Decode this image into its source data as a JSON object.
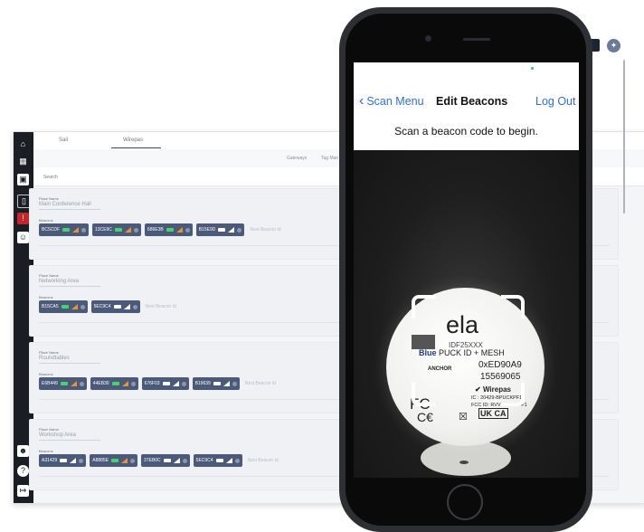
{
  "desktop": {
    "top_tabs": [
      "Sail",
      "Wirepas"
    ],
    "sub_tabs": [
      "Gateways",
      "Tag Man"
    ],
    "search_label": "Search",
    "place_name_label": "Place Name",
    "beacons_label": "Beacons",
    "next_beacon_placeholder": "Next Beacon Id",
    "places": [
      {
        "name": "Main Conference Hall",
        "beacons": [
          {
            "id": "BC5CDF",
            "battery": "green",
            "signal": "orange"
          },
          {
            "id": "13CE9C",
            "battery": "green",
            "signal": "orange"
          },
          {
            "id": "686E3B",
            "battery": "green",
            "signal": "orange"
          },
          {
            "id": "B15E9D",
            "battery": "white",
            "signal": "white"
          }
        ]
      },
      {
        "name": "Networking Area",
        "beacons": [
          {
            "id": "B15CA5",
            "battery": "green",
            "signal": "orange"
          },
          {
            "id": "5EC9C4",
            "battery": "white",
            "signal": "white"
          }
        ]
      },
      {
        "name": "Roundtables",
        "beacons": [
          {
            "id": "E6B449",
            "battery": "green",
            "signal": "orange"
          },
          {
            "id": "44EB30",
            "battery": "green",
            "signal": "orange"
          },
          {
            "id": "676F03",
            "battery": "white",
            "signal": "white"
          },
          {
            "id": "B19639",
            "battery": "white",
            "signal": "white"
          }
        ]
      },
      {
        "name": "Workshop Area",
        "beacons": [
          {
            "id": "A31429",
            "battery": "white",
            "signal": "white"
          },
          {
            "id": "A8885E",
            "battery": "green",
            "signal": "orange"
          },
          {
            "id": "37EB0C",
            "battery": "white",
            "signal": "white"
          },
          {
            "id": "5EC9C4",
            "battery": "white",
            "signal": "white"
          }
        ]
      }
    ]
  },
  "phone": {
    "nav_back": "Scan Menu",
    "nav_title": "Edit Beacons",
    "nav_logout": "Log Out",
    "prompt": "Scan a beacon code to begin.",
    "puck": {
      "logo": "ela",
      "model": "IDF25XXX",
      "blue_word": "Blue",
      "line1_rest": " PUCK ID + MESH",
      "anchor": "ANCHOR",
      "device_id": "0xED90A9",
      "serial": "15569065",
      "wirepas": "Wirepas",
      "ic": "IC : 20429-BPUCKPF1",
      "fcc": "FCC ID: RVVBPUCKPF1",
      "fc_mark": "FC",
      "ce_mark": "C€",
      "ukca": "UK CA"
    }
  }
}
